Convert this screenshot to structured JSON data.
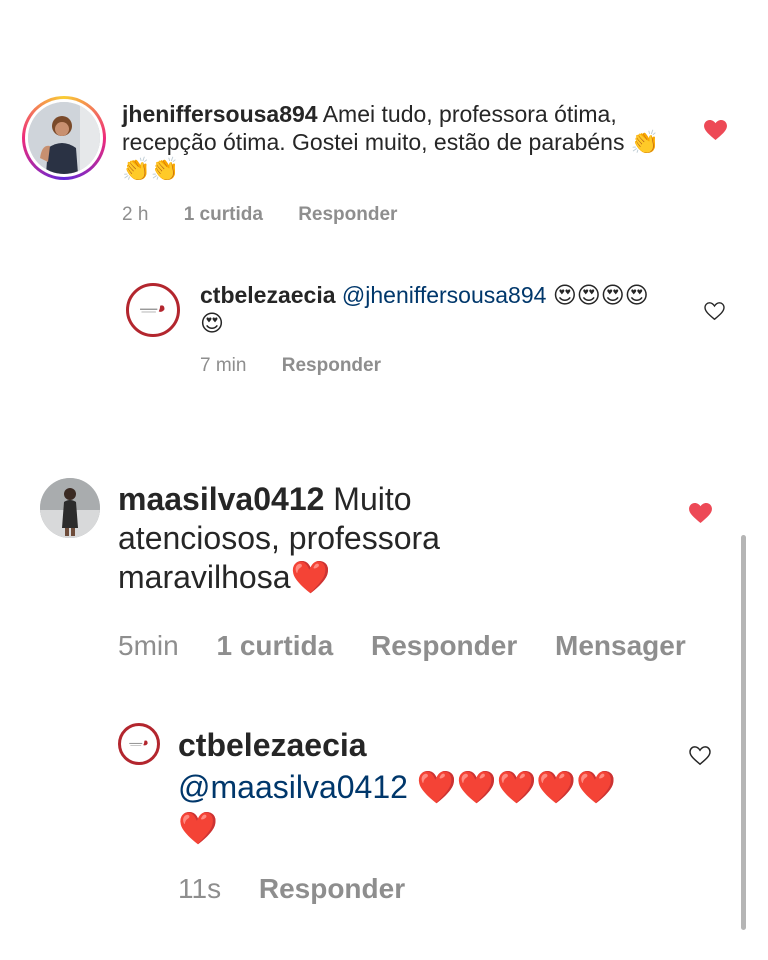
{
  "comments": [
    {
      "username": "jheniffersousa894",
      "text": " Amei tudo, professora ótima, recepção ótima. Gostei muito, estão de parabéns 👏👏👏",
      "time": "2 h",
      "likes": "1 curtida",
      "reply": "Responder",
      "liked": true,
      "reply_comment": {
        "username": "ctbelezaecia",
        "mention": "@jheniffersousa894",
        "text": " 😍😍😍😍😍",
        "time": "7 min",
        "reply": "Responder",
        "liked": false
      }
    },
    {
      "username": "maasilva0412",
      "text": " Muito atenciosos, professora maravilhosa❤️",
      "time": "5min",
      "likes": "1 curtida",
      "reply": "Responder",
      "message": "Mensager",
      "liked": true,
      "reply_comment": {
        "username": "ctbelezaecia",
        "mention": "@maasilva0412",
        "text": " ❤️❤️❤️❤️❤️❤️",
        "time": "11s",
        "reply": "Responder",
        "liked": false
      }
    }
  ],
  "icons": {
    "like_filled": "heart-filled-icon",
    "like_outline": "heart-outline-icon"
  },
  "colors": {
    "like_red": "#ed4956",
    "mention_blue": "#00376b",
    "meta_gray": "#8e8e8e"
  }
}
